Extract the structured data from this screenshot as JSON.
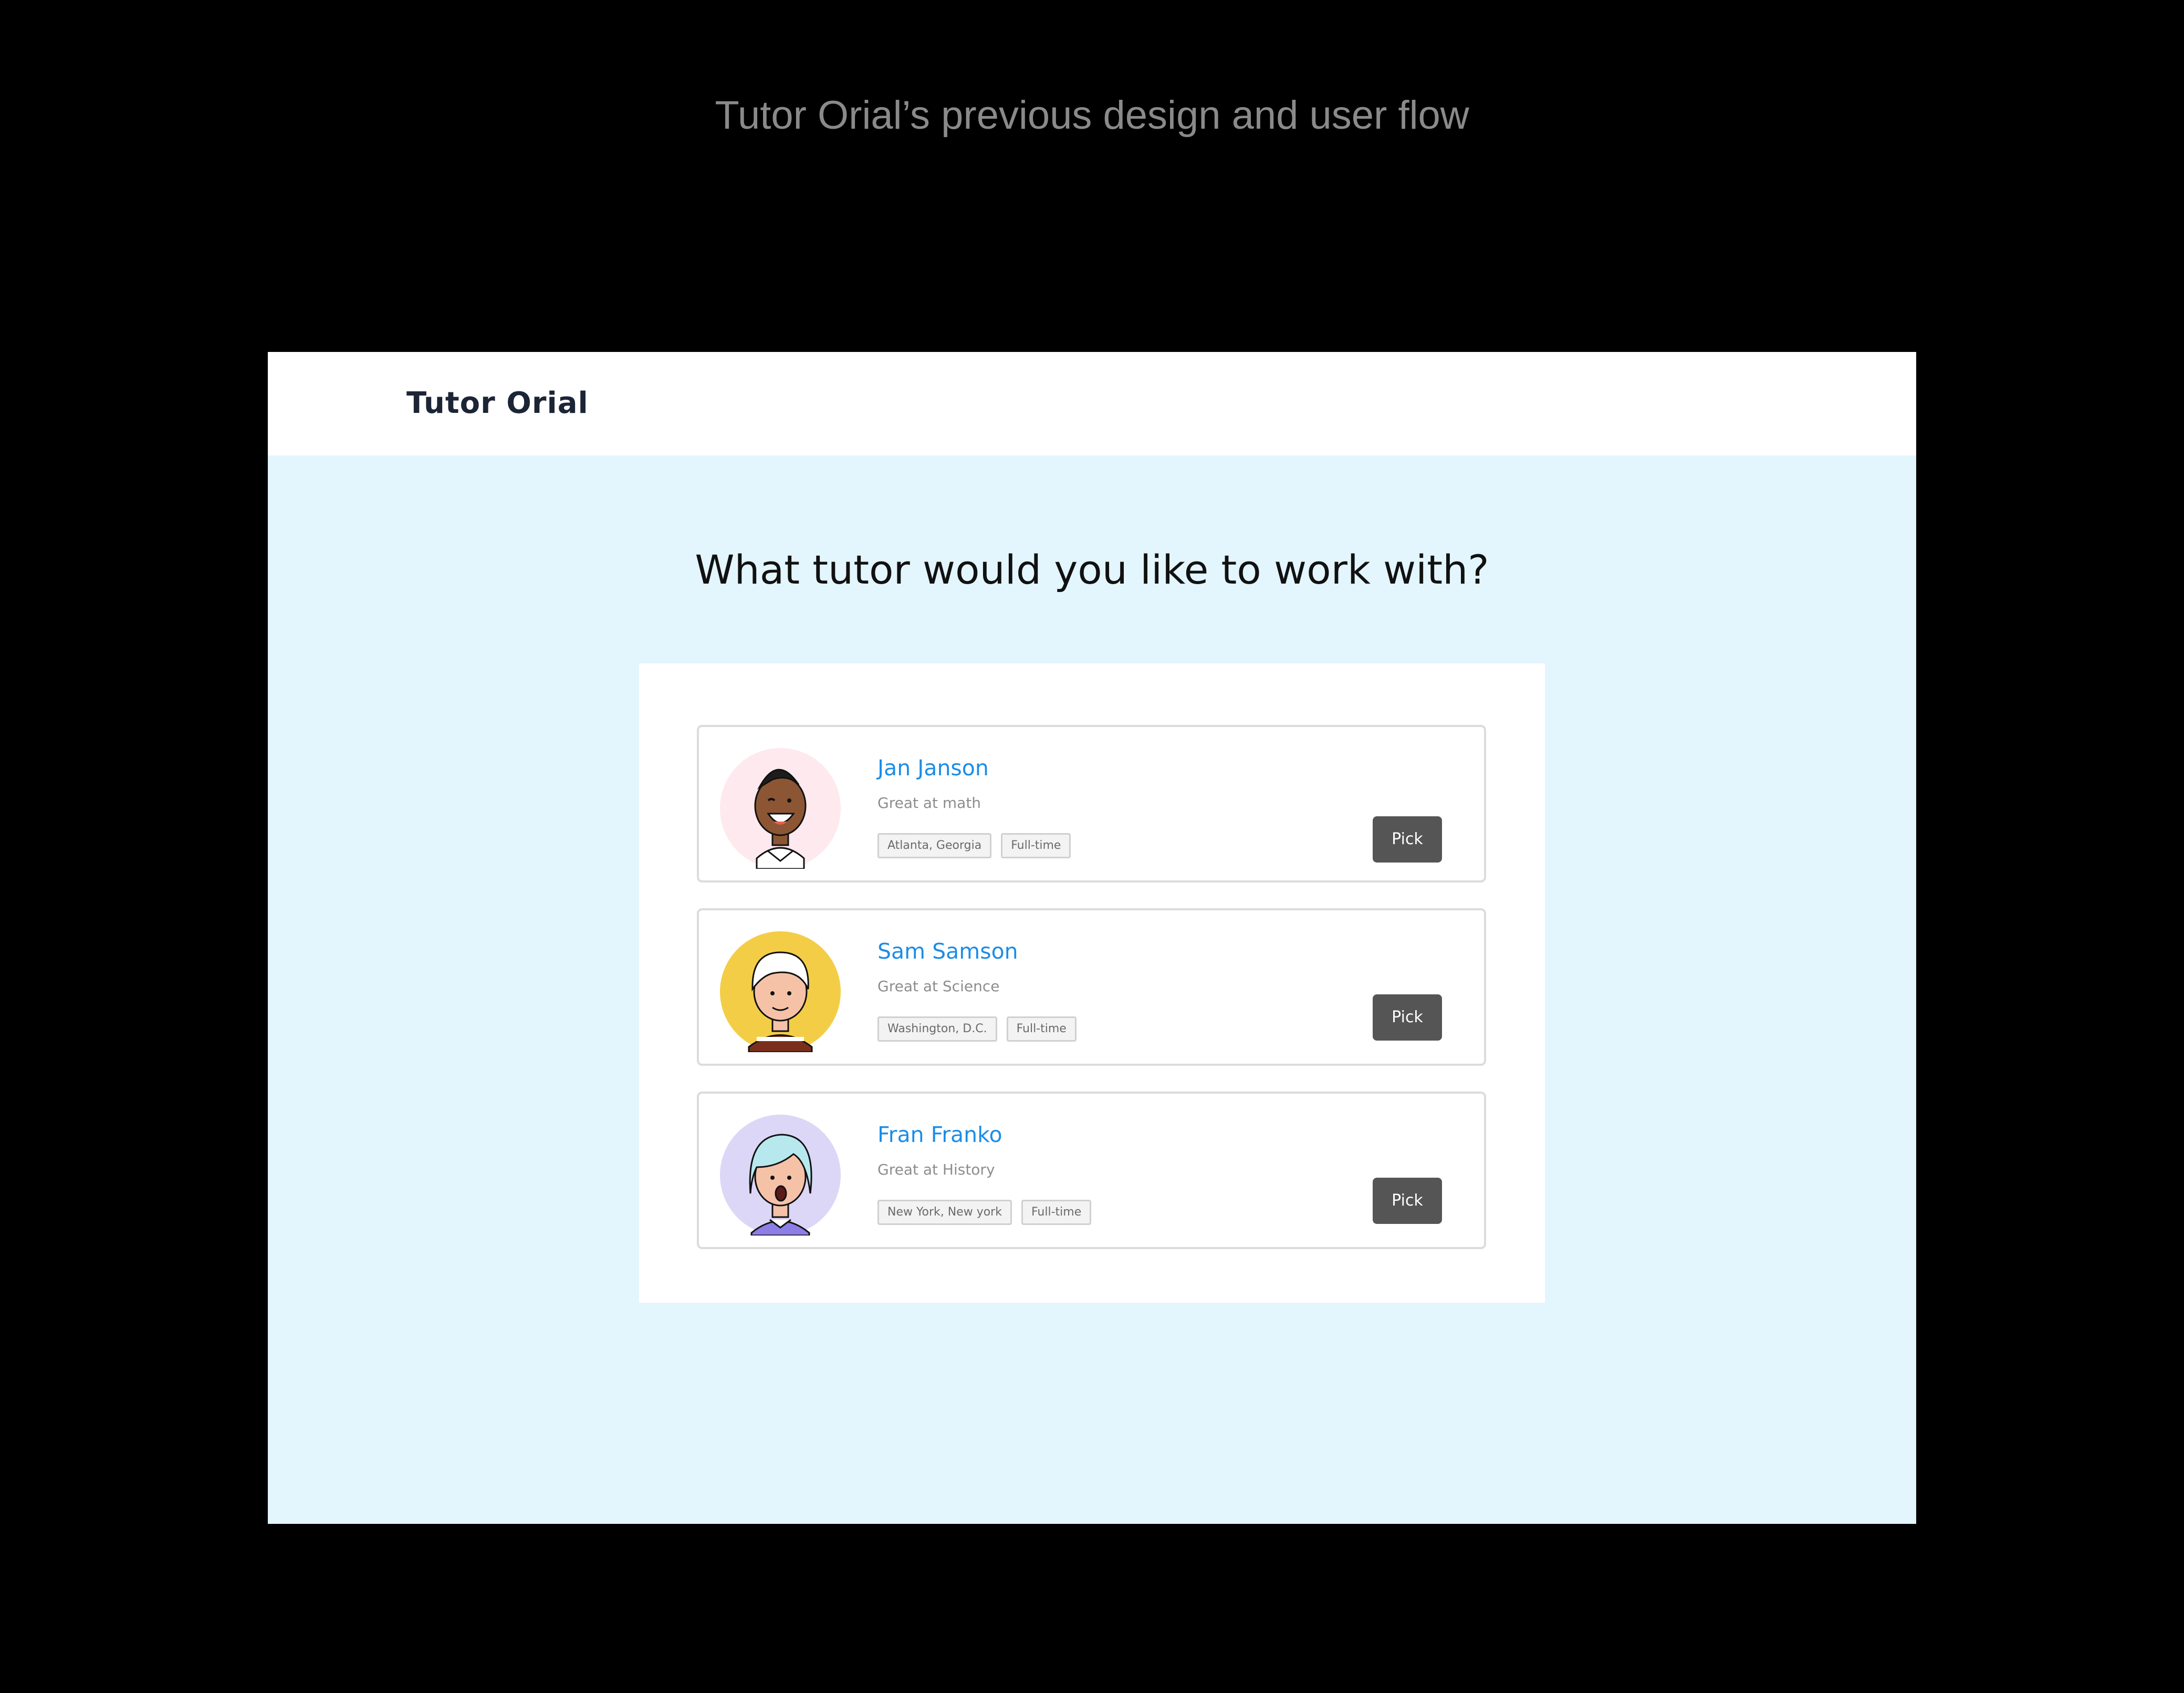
{
  "caption": "Tutor Orial’s previous design and user flow",
  "app": {
    "brand": "Tutor Orial",
    "question": "What tutor would you like to work with?"
  },
  "tutors": [
    {
      "name": "Jan Janson",
      "subject": "Great at math",
      "tags": [
        "Atlanta, Georgia",
        "Full-time"
      ],
      "action": "Pick",
      "avatar_icon": "smiling-man-avatar-icon",
      "avatar_bg": "#fde9ee"
    },
    {
      "name": "Sam Samson",
      "subject": "Great at Science",
      "tags": [
        "Washington, D.C.",
        "Full-time"
      ],
      "action": "Pick",
      "avatar_icon": "blond-man-avatar-icon",
      "avatar_bg": "#f4cd47"
    },
    {
      "name": "Fran Franko",
      "subject": "Great at History",
      "tags": [
        "New York, New york",
        "Full-time"
      ],
      "action": "Pick",
      "avatar_icon": "surprised-woman-avatar-icon",
      "avatar_bg": "#dcd7f7"
    }
  ],
  "colors": {
    "page_bg": "#e3f5fd",
    "name_blue": "#1a8de8",
    "button_gray": "#555555"
  }
}
